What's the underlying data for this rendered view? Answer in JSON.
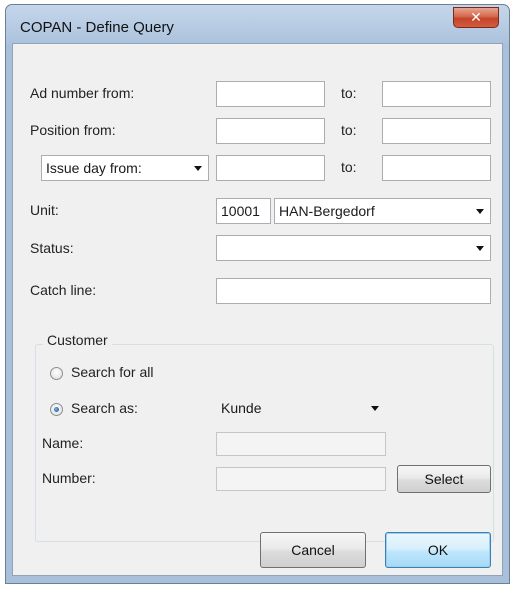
{
  "window": {
    "title": "COPAN - Define Query",
    "close_glyph": "✕"
  },
  "form": {
    "ad_number": {
      "label": "Ad number from:",
      "from_value": "",
      "to_label": "to:",
      "to_value": ""
    },
    "position": {
      "label": "Position from:",
      "from_value": "",
      "to_label": "to:",
      "to_value": ""
    },
    "issue_day": {
      "selected": "Issue day from:",
      "from_value": "",
      "to_label": "to:",
      "to_value": ""
    },
    "unit": {
      "label": "Unit:",
      "code": "10001",
      "name": "HAN-Bergedorf"
    },
    "status": {
      "label": "Status:",
      "value": ""
    },
    "catch_line": {
      "label": "Catch line:",
      "value": ""
    }
  },
  "customer": {
    "group_title": "Customer",
    "search_all_label": "Search for all",
    "search_all_checked": false,
    "search_as_label": "Search as:",
    "search_as_checked": true,
    "search_as_value": "Kunde",
    "name_label": "Name:",
    "name_value": "",
    "number_label": "Number:",
    "number_value": "",
    "select_label": "Select"
  },
  "buttons": {
    "cancel": "Cancel",
    "ok": "OK"
  },
  "icons": {
    "close": "close-icon",
    "dropdown": "chevron-down-icon",
    "radio": "radio-icon"
  }
}
